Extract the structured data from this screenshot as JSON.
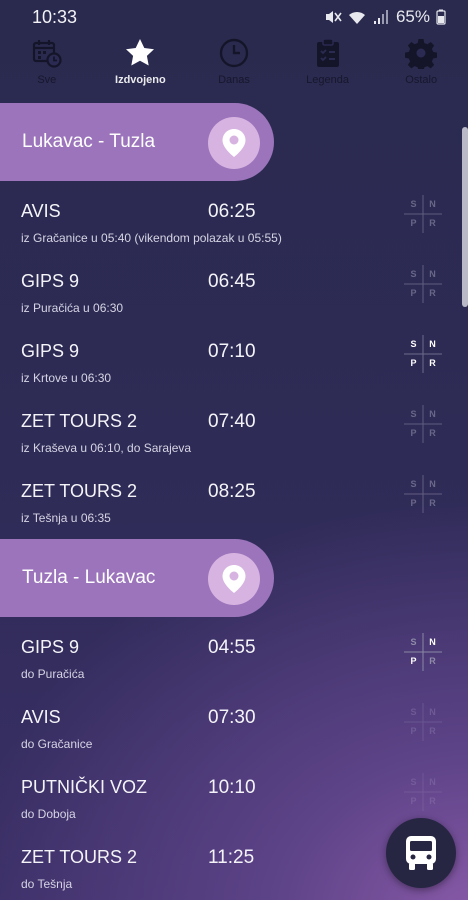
{
  "status_bar": {
    "time": "10:33",
    "battery": "65%"
  },
  "nav": {
    "items": [
      {
        "label": "Sve",
        "icon": "calendar-clock-icon",
        "active": false
      },
      {
        "label": "Izdvojeno",
        "icon": "star-icon",
        "active": true
      },
      {
        "label": "Danas",
        "icon": "clock-icon",
        "active": false
      },
      {
        "label": "Legenda",
        "icon": "clipboard-list-icon",
        "active": false
      },
      {
        "label": "Ostalo",
        "icon": "gear-icon",
        "active": false
      }
    ]
  },
  "sections": [
    {
      "title": "Lukavac - Tuzla",
      "departures": [
        {
          "line": "AVIS",
          "time": "06:25",
          "note": "iz Gračanice u 05:40 (vikendom polazak u 05:55)",
          "snpr_active": [
            "S",
            "N",
            "P",
            "R"
          ],
          "strength": "dim"
        },
        {
          "line": "GIPS 9",
          "time": "06:45",
          "note": "iz Puračića u 06:30",
          "strength": "dim"
        },
        {
          "line": "GIPS 9",
          "time": "07:10",
          "note": "iz Krtove u 06:30",
          "strength": "bright"
        },
        {
          "line": "ZET TOURS 2",
          "time": "07:40",
          "note": "iz Kraševa u 06:10, do Sarajeva",
          "strength": "dim"
        },
        {
          "line": "ZET TOURS 2",
          "time": "08:25",
          "note": "iz Tešnja u 06:35",
          "strength": "dim"
        }
      ]
    },
    {
      "title": "Tuzla - Lukavac",
      "departures": [
        {
          "line": "GIPS 9",
          "time": "04:55",
          "note": "do Puračića",
          "strength": "mixed"
        },
        {
          "line": "AVIS",
          "time": "07:30",
          "note": "do Gračanice",
          "strength": "faint"
        },
        {
          "line": "PUTNIČKI VOZ",
          "time": "10:10",
          "note": "do Doboja",
          "strength": "faint"
        },
        {
          "line": "ZET TOURS 2",
          "time": "11:25",
          "note": "do Tešnja",
          "strength": "faint"
        }
      ]
    }
  ],
  "snpr_labels": [
    "S",
    "N",
    "P",
    "R"
  ],
  "colors": {
    "header_bg": "#9b74bb",
    "pin_bg": "#d6b3e0",
    "fab_bg": "#262643"
  },
  "fab": {
    "icon": "bus-icon"
  }
}
